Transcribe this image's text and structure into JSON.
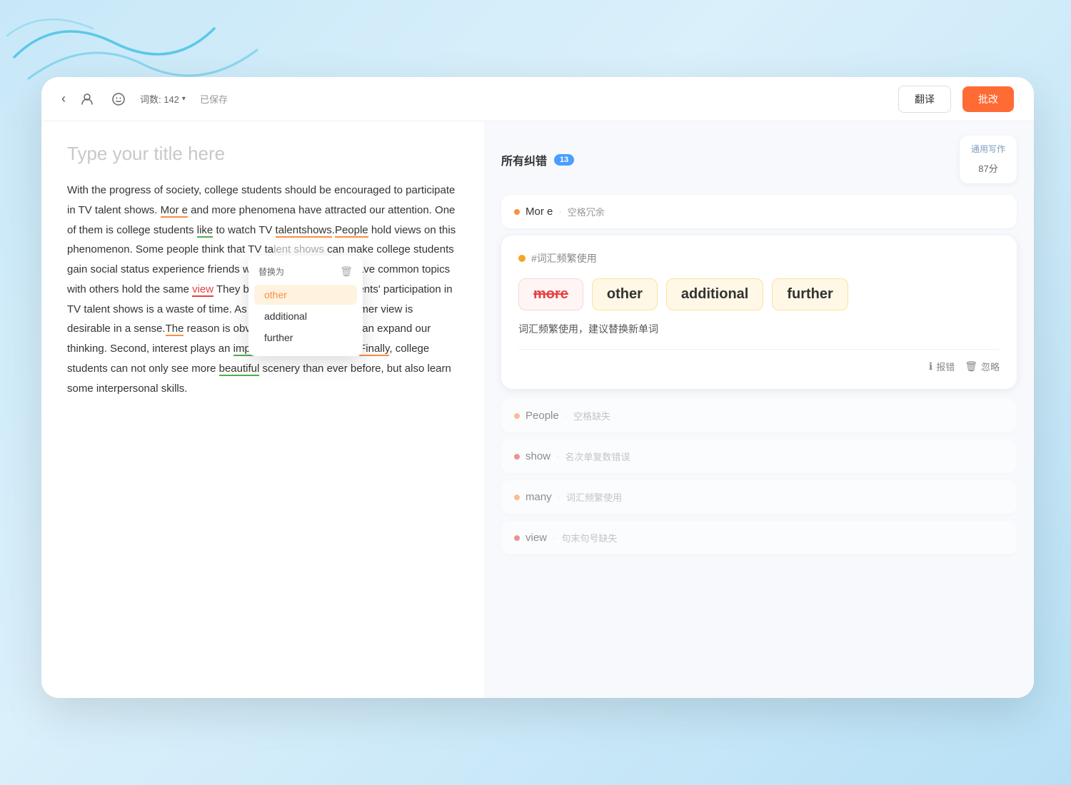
{
  "background": {
    "gradient_start": "#c8e8f8",
    "gradient_end": "#b8e0f5"
  },
  "toolbar": {
    "wordcount_label": "词数: 142",
    "saved_label": "已保存",
    "translate_label": "翻译",
    "proofread_label": "批改"
  },
  "editor": {
    "title_placeholder": "Type your title here",
    "body_text": "With the progress of society, college students should be encouraged to participate in TV talent shows. Mor e and more phenomena have attracted our attention. One of them is college students like to watch TV talentshows.People hold views on this phenomenon. Some people think that TV talent shows can make college students gain social status experience friends with many people who have common topics with others hold the same view They believe that college students' participation in TV talent shows is a waste of time. As far as I can see, the former view is desirable in a sense.The reason is obvious. These programs can expand our thinking. Second, interest plays an important role in our study.Finally, college students can not only see more beautiful scenery than ever before, but also learn some interpersonal skills."
  },
  "suggestion_popup": {
    "header": "替换为",
    "items": [
      "other",
      "additional",
      "further"
    ]
  },
  "right_panel": {
    "errors_title": "所有纠错",
    "errors_count": "13",
    "score_section_label": "通用写作",
    "score_value": "87",
    "score_unit": "分",
    "big_card": {
      "tag": "#词汇频繁使用",
      "original_word": "more",
      "replacement_words": [
        "other",
        "additional",
        "further"
      ],
      "description": "词汇频繁使用，建议替换新单词",
      "report_label": "报错",
      "ignore_label": "忽略"
    },
    "error_items": [
      {
        "word": "Mor e",
        "type": "空格冗余",
        "dot_color": "orange"
      },
      {
        "word": "People",
        "type": "空格缺失",
        "dot_color": "orange"
      },
      {
        "word": "show",
        "type": "名次单复数错误",
        "dot_color": "red"
      },
      {
        "word": "many",
        "type": "词汇频繁使用",
        "dot_color": "orange"
      },
      {
        "word": "view",
        "type": "句末句号缺失",
        "dot_color": "red"
      }
    ]
  }
}
